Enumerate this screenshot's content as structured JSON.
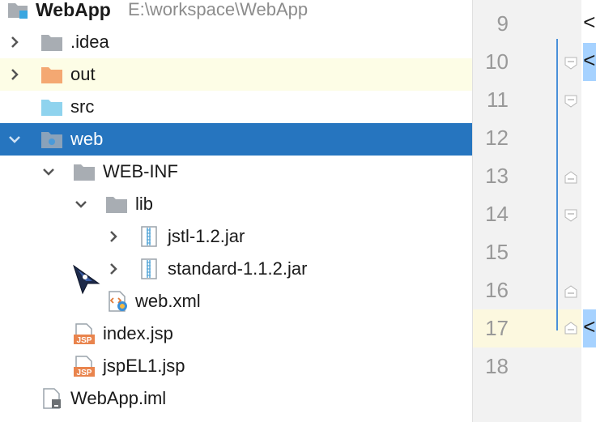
{
  "project": {
    "name": "WebApp",
    "path": "E:\\workspace\\WebApp"
  },
  "tree": [
    {
      "label": "WebApp",
      "icon": "module-icon",
      "arrow": "",
      "indent": 0
    },
    {
      "label": ".idea",
      "icon": "folder-gray-icon",
      "arrow": "collapsed",
      "indent": 1
    },
    {
      "label": "out",
      "icon": "folder-orange-icon",
      "arrow": "collapsed",
      "indent": 1
    },
    {
      "label": "src",
      "icon": "folder-blue-icon",
      "arrow": "",
      "indent": 1
    },
    {
      "label": "web",
      "icon": "folder-web-icon",
      "arrow": "expanded",
      "indent": 1
    },
    {
      "label": "WEB-INF",
      "icon": "folder-gray-icon",
      "arrow": "expanded",
      "indent": 2
    },
    {
      "label": "lib",
      "icon": "folder-gray-icon",
      "arrow": "expanded",
      "indent": 3
    },
    {
      "label": "jstl-1.2.jar",
      "icon": "jar-icon",
      "arrow": "collapsed",
      "indent": 4
    },
    {
      "label": "standard-1.1.2.jar",
      "icon": "jar-icon",
      "arrow": "collapsed",
      "indent": 4
    },
    {
      "label": "web.xml",
      "icon": "xml-icon",
      "arrow": "",
      "indent": 3
    },
    {
      "label": "index.jsp",
      "icon": "jsp-icon",
      "arrow": "",
      "indent": 2
    },
    {
      "label": "jspEL1.jsp",
      "icon": "jsp-icon",
      "arrow": "",
      "indent": 2
    },
    {
      "label": "WebApp.iml",
      "icon": "iml-icon",
      "arrow": "",
      "indent": 1
    }
  ],
  "jsp_badge": "JSP",
  "editor": {
    "line_numbers": [
      "9",
      "10",
      "11",
      "12",
      "13",
      "14",
      "15",
      "16",
      "17",
      "18"
    ],
    "code_glyph": "<"
  },
  "colors": {
    "selection": "#2675bf",
    "highlight": "#fdfde6",
    "folder_gray": "#a8adb3",
    "folder_orange": "#f4a872",
    "folder_blue": "#8fd3ee"
  }
}
